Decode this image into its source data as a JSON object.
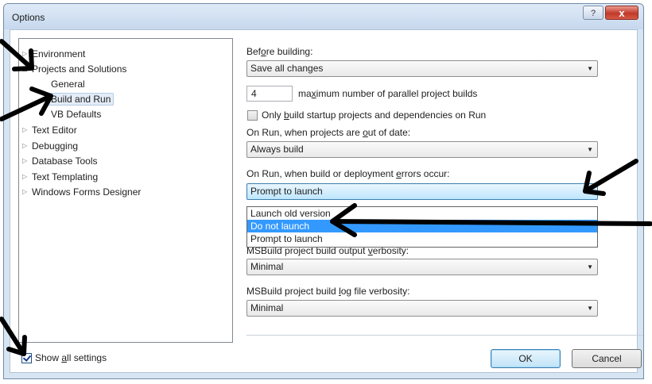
{
  "window": {
    "title": "Options",
    "help_label": "?",
    "close_label": "x"
  },
  "tree": {
    "items": [
      {
        "label": "Environment",
        "arrow": "▷"
      },
      {
        "label": "Projects and Solutions",
        "arrow": "◢"
      },
      {
        "label": "General",
        "arrow": ""
      },
      {
        "label": "Build and Run",
        "arrow": ""
      },
      {
        "label": "VB Defaults",
        "arrow": ""
      },
      {
        "label": "Text Editor",
        "arrow": "▷"
      },
      {
        "label": "Debugging",
        "arrow": "▷"
      },
      {
        "label": "Database Tools",
        "arrow": "▷"
      },
      {
        "label": "Text Templating",
        "arrow": "▷"
      },
      {
        "label": "Windows Forms Designer",
        "arrow": "▷"
      }
    ]
  },
  "settings": {
    "before_building": {
      "pre": "Bef",
      "ul": "o",
      "post": "re building:",
      "value": "Save all changes"
    },
    "parallel": {
      "value": "4",
      "pre": "ma",
      "ul": "x",
      "post": "imum number of parallel project builds"
    },
    "only_build": {
      "pre": "Only ",
      "ul": "b",
      "post": "uild startup projects and dependencies on Run",
      "checked": false
    },
    "out_of_date": {
      "pre": "On Run, when projects are ",
      "ul": "o",
      "post": "ut of date:",
      "value": "Always build"
    },
    "errors": {
      "pre": "On Run, when build or deployment ",
      "ul": "e",
      "post": "rrors occur:",
      "value": "Prompt to launch"
    },
    "dropdown_options": [
      "Launch old version",
      "Do not launch",
      "Prompt to launch"
    ],
    "output_verbosity": {
      "pre": "MSBuild project build output ",
      "ul": "v",
      "post": "erbosity:",
      "value": "Minimal"
    },
    "log_verbosity": {
      "pre": "MSBuild project build ",
      "ul": "l",
      "post": "og file verbosity:",
      "value": "Minimal"
    }
  },
  "footer": {
    "show_all": {
      "pre": "Show ",
      "ul": "a",
      "post": "ll settings",
      "checked": true
    },
    "ok_label": "OK",
    "cancel_label": "Cancel"
  },
  "colors": {
    "accent": "#3399ff",
    "annotation": "#000000"
  }
}
